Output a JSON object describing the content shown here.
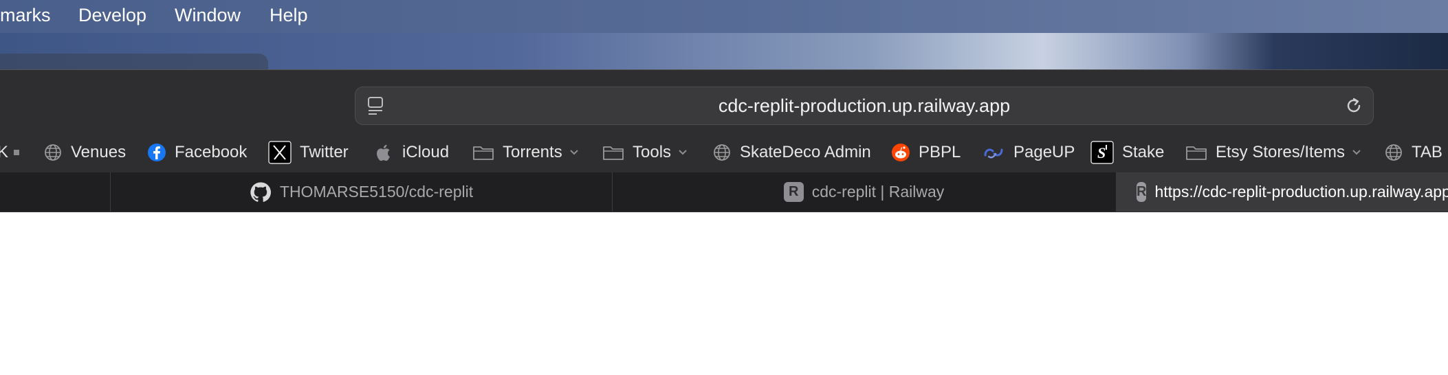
{
  "menubar": {
    "items": [
      "marks",
      "Develop",
      "Window",
      "Help"
    ]
  },
  "addressbar": {
    "url": "cdc-replit-production.up.railway.app"
  },
  "bookmarks": {
    "partial_label": "K",
    "items": [
      {
        "label": "Venues",
        "icon": "globe-icon"
      },
      {
        "label": "Facebook",
        "icon": "facebook-icon"
      },
      {
        "label": "Twitter",
        "icon": "x-twitter-icon"
      },
      {
        "label": "iCloud",
        "icon": "apple-icon"
      },
      {
        "label": "Torrents",
        "icon": "folder-icon"
      },
      {
        "label": "Tools",
        "icon": "folder-icon"
      },
      {
        "label": "SkateDeco Admin",
        "icon": "globe-icon"
      },
      {
        "label": "PBPL",
        "icon": "reddit-icon"
      },
      {
        "label": "PageUP",
        "icon": "pageup-icon"
      },
      {
        "label": "Stake",
        "icon": "stake-icon"
      },
      {
        "label": "Etsy Stores/Items",
        "icon": "folder-icon"
      },
      {
        "label": "TAB",
        "icon": "globe-icon"
      }
    ]
  },
  "tabs": [
    {
      "title": "THOMARSE5150/cdc-replit",
      "icon": "github-icon"
    },
    {
      "title": "cdc-replit | Railway",
      "icon": "R"
    },
    {
      "title": "https://cdc-replit-production.up.railway.app",
      "icon": "R"
    }
  ],
  "colors": {
    "chrome": "#2e2e30",
    "tabbar": "#1f1f21",
    "active_tab": "#3a3a3c",
    "menubar": "#566b95",
    "facebook": "#1877f2",
    "reddit": "#ff4500"
  }
}
